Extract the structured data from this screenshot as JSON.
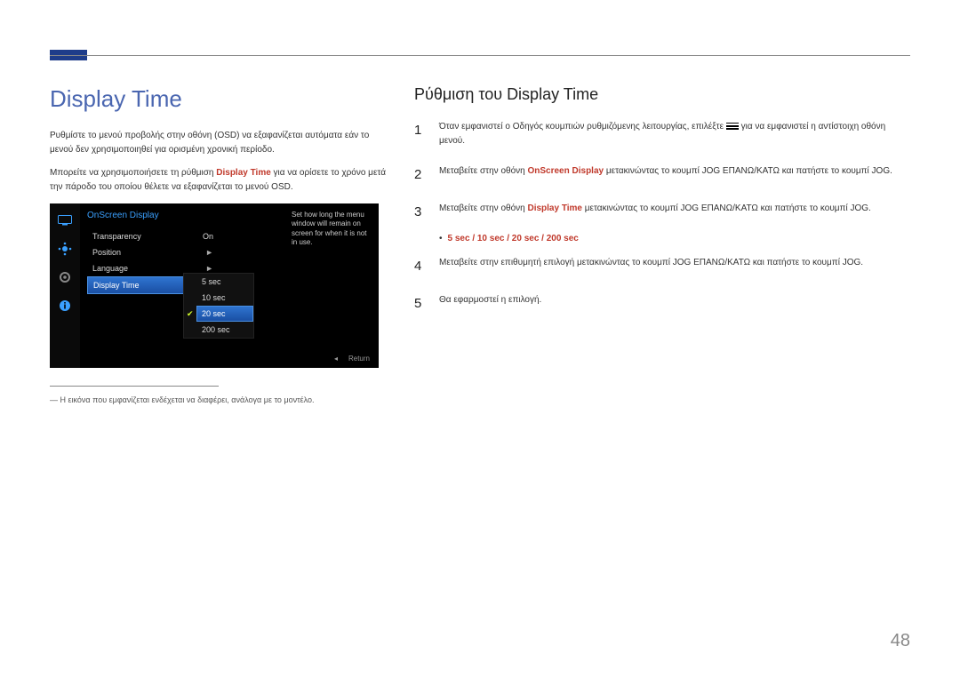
{
  "page": {
    "number": "48"
  },
  "left": {
    "title": "Display Time",
    "p1": "Ρυθμίστε το μενού προβολής στην οθόνη (OSD) να εξαφανίζεται αυτόματα εάν το μενού δεν χρησιμοποιηθεί για ορισμένη χρονική περίοδο.",
    "p2a": "Μπορείτε να χρησιμοποιήσετε τη ρύθμιση ",
    "p2hl": "Display Time",
    "p2b": " για να ορίσετε το χρόνο μετά την πάροδο του οποίου θέλετε να εξαφανίζεται το μενού OSD.",
    "footnote": "Η εικόνα που εμφανίζεται ενδέχεται να διαφέρει, ανάλογα με το μοντέλο."
  },
  "osd": {
    "header": "OnScreen Display",
    "menu": [
      {
        "label": "Transparency",
        "value": "On"
      },
      {
        "label": "Position",
        "value": "►"
      },
      {
        "label": "Language",
        "value": "►"
      },
      {
        "label": "Display Time",
        "value": "►",
        "selected": true
      }
    ],
    "options": [
      "5 sec",
      "10 sec",
      "20 sec",
      "200 sec"
    ],
    "selected_option": "20 sec",
    "tip": "Set how long the menu window will remain on screen for when it is not in use.",
    "return": "Return"
  },
  "right": {
    "title": "Ρύθμιση του Display Time",
    "steps": {
      "s1a": "Όταν εμφανιστεί ο Οδηγός κουμπιών ρυθμιζόμενης λειτουργίας, επιλέξτε ",
      "s1b": " για να εμφανιστεί η αντίστοιχη οθόνη μενού.",
      "s2a": "Μεταβείτε στην οθόνη ",
      "s2hl": "OnScreen Display",
      "s2b": " μετακινώντας το κουμπί JOG ΕΠΑΝΩ/ΚΑΤΩ και πατήστε το κουμπί JOG.",
      "s3a": "Μεταβείτε στην οθόνη ",
      "s3hl": "Display Time",
      "s3b": " μετακινώντας το κουμπί JOG ΕΠΑΝΩ/ΚΑΤΩ και πατήστε το κουμπί JOG.",
      "options": "5 sec / 10 sec / 20 sec / 200 sec",
      "s4": "Μεταβείτε στην επιθυμητή επιλογή μετακινώντας το κουμπί JOG ΕΠΑΝΩ/ΚΑΤΩ και πατήστε το κουμπί JOG.",
      "s5": "Θα εφαρμοστεί η επιλογή."
    }
  }
}
